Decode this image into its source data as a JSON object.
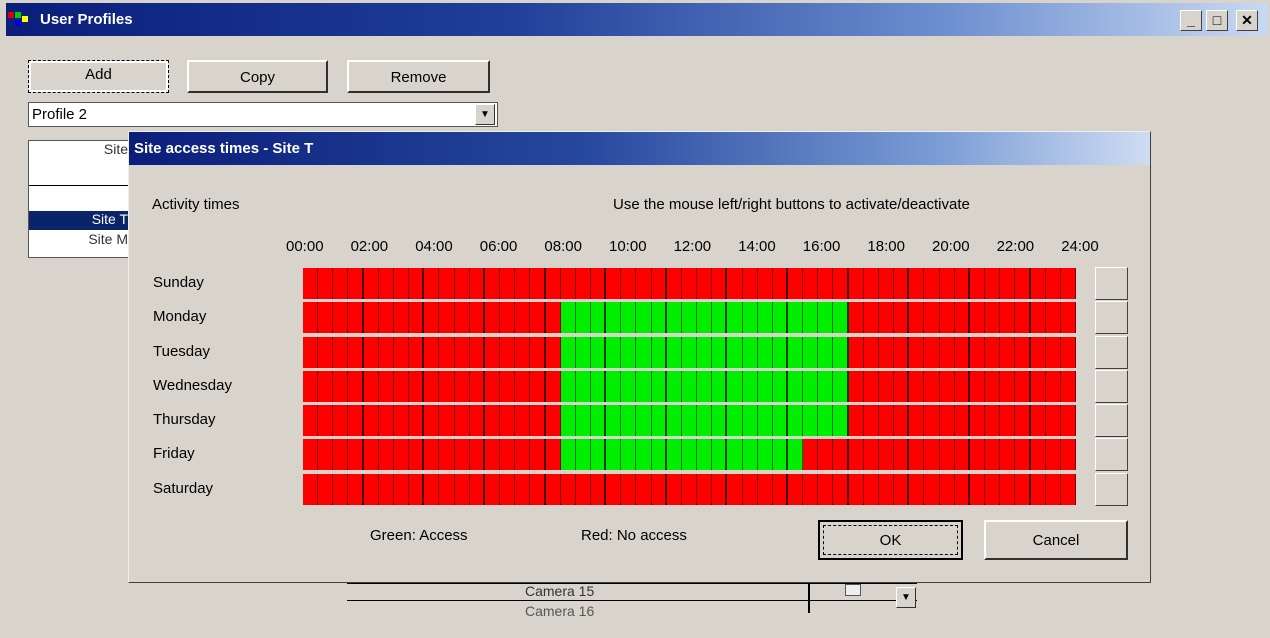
{
  "window": {
    "title": "User Profiles",
    "minimize": "_",
    "maximize": "□",
    "close": "✕"
  },
  "toolbar": {
    "add_label": "Add",
    "copy_label": "Copy",
    "remove_label": "Remove"
  },
  "profile_select": {
    "value": "Profile 2"
  },
  "site_list": {
    "header": "Site",
    "items": [
      "Site T",
      "Site M"
    ]
  },
  "camera_list": {
    "items": [
      "Camera  15",
      "Camera  16"
    ]
  },
  "dialog": {
    "title": "Site access times - Site T",
    "activity_label": "Activity times",
    "instructions": "Use the mouse left/right buttons to activate/deactivate",
    "time_labels": [
      "00:00",
      "02:00",
      "04:00",
      "06:00",
      "08:00",
      "10:00",
      "12:00",
      "14:00",
      "16:00",
      "18:00",
      "20:00",
      "22:00",
      "24:00"
    ],
    "days": [
      {
        "name": "Sunday",
        "access_from": null,
        "access_to": null
      },
      {
        "name": "Monday",
        "access_from": "08:00",
        "access_to": "17:00"
      },
      {
        "name": "Tuesday",
        "access_from": "08:00",
        "access_to": "17:00"
      },
      {
        "name": "Wednesday",
        "access_from": "08:00",
        "access_to": "17:00"
      },
      {
        "name": "Thursday",
        "access_from": "08:00",
        "access_to": "17:00"
      },
      {
        "name": "Friday",
        "access_from": "08:00",
        "access_to": "15:30"
      },
      {
        "name": "Saturday",
        "access_from": null,
        "access_to": null
      }
    ],
    "legend_green": "Green: Access",
    "legend_red": "Red: No access",
    "ok_label": "OK",
    "cancel_label": "Cancel",
    "colors": {
      "access": "#00ee00",
      "no_access": "#ff0000"
    }
  }
}
